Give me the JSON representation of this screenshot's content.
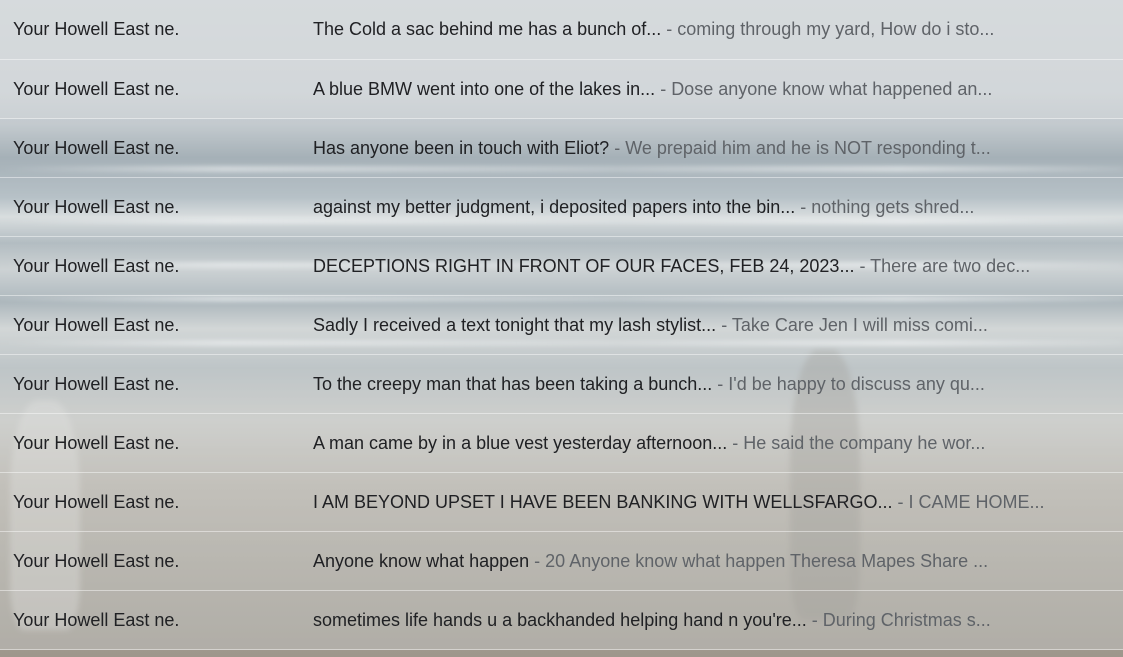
{
  "inbox": {
    "rows": [
      {
        "sender": "Your Howell East ne.",
        "subject": "The Cold a sac behind me has a bunch of...",
        "separator": " - ",
        "snippet": "coming through my yard, How do i sto..."
      },
      {
        "sender": "Your Howell East ne.",
        "subject": "A blue BMW went into one of the lakes in...",
        "separator": " - ",
        "snippet": "Dose anyone know what happened an..."
      },
      {
        "sender": "Your Howell East ne.",
        "subject": "Has anyone been in touch with Eliot?",
        "separator": " - ",
        "snippet": "We prepaid him and he is NOT responding t..."
      },
      {
        "sender": "Your Howell East ne.",
        "subject": "against my better judgment, i deposited papers into the bin...",
        "separator": " - ",
        "snippet": "nothing gets shred..."
      },
      {
        "sender": "Your Howell East ne.",
        "subject": "DECEPTIONS RIGHT IN FRONT OF OUR FACES, FEB 24, 2023...",
        "separator": " - ",
        "snippet": "There are two dec..."
      },
      {
        "sender": "Your Howell East ne.",
        "subject": "Sadly I received a text tonight that my lash stylist...",
        "separator": " - ",
        "snippet": "Take Care Jen I will miss comi..."
      },
      {
        "sender": "Your Howell East ne.",
        "subject": "To the creepy man that has been taking a bunch...",
        "separator": " - ",
        "snippet": "I'd be happy to discuss any qu..."
      },
      {
        "sender": "Your Howell East ne.",
        "subject": "A man came by in a blue vest yesterday afternoon...",
        "separator": " - ",
        "snippet": "He said the company he wor..."
      },
      {
        "sender": "Your Howell East ne.",
        "subject": "I AM BEYOND UPSET I HAVE BEEN BANKING WITH WELLSFARGO...",
        "separator": " - ",
        "snippet": "I CAME HOME..."
      },
      {
        "sender": "Your Howell East ne.",
        "subject": "Anyone know what happen",
        "separator": " - ",
        "snippet": "20 Anyone know what happen Theresa Mapes Share ..."
      },
      {
        "sender": "Your Howell East ne.",
        "subject": "sometimes life hands u a backhanded helping hand n you're...",
        "separator": " - ",
        "snippet": "During Christmas s..."
      }
    ]
  }
}
